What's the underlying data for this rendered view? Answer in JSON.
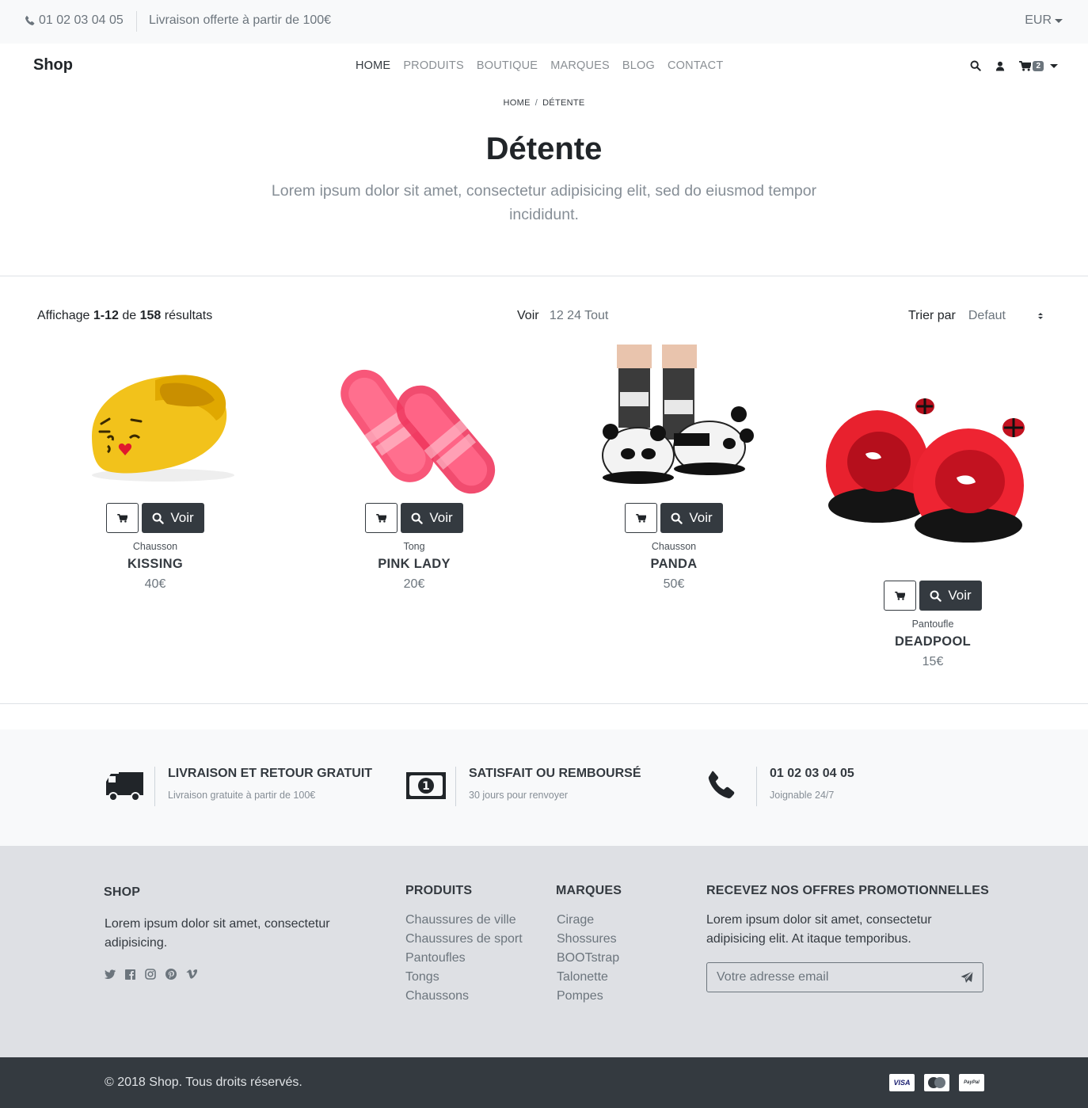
{
  "topbar": {
    "phone": "01 02 03 04 05",
    "delivery": "Livraison offerte à partir de 100€",
    "currency": "EUR"
  },
  "nav": {
    "brand": "Shop",
    "links": [
      "HOME",
      "PRODUITS",
      "BOUTIQUE",
      "MARQUES",
      "BLOG",
      "CONTACT"
    ],
    "cart_count": "2"
  },
  "hero": {
    "breadcrumb": [
      "HOME",
      "DÉTENTE"
    ],
    "title": "Détente",
    "lead": "Lorem ipsum dolor sit amet, consectetur adipisicing elit, sed do eiusmod tempor incididunt."
  },
  "listing": {
    "prefix": "Affichage",
    "range": "1-12",
    "of": "de",
    "total": "158",
    "suffix": "résultats",
    "per_page_label": "Voir",
    "per_page_options": [
      "12",
      "24",
      "Tout"
    ],
    "sort_label": "Trier par",
    "sort_value": "Defaut"
  },
  "products": [
    {
      "category": "Chausson",
      "name": "KISSING",
      "price": "40€",
      "button": "Voir"
    },
    {
      "category": "Tong",
      "name": "PINK LADY",
      "price": "20€",
      "button": "Voir"
    },
    {
      "category": "Chausson",
      "name": "PANDA",
      "price": "50€",
      "button": "Voir"
    },
    {
      "category": "Pantoufle",
      "name": "DEADPOOL",
      "price": "15€",
      "button": "Voir"
    }
  ],
  "services": [
    {
      "title": "LIVRAISON ET RETOUR GRATUIT",
      "subtitle": "Livraison gratuite à partir de 100€",
      "icon": "truck-icon"
    },
    {
      "title": "SATISFAIT OU REMBOURSÉ",
      "subtitle": "30 jours pour renvoyer",
      "icon": "money-icon"
    },
    {
      "title": "01 02 03 04 05",
      "subtitle": "Joignable 24/7",
      "icon": "phone-icon"
    }
  ],
  "footer": {
    "shop": {
      "heading": "SHOP",
      "text": "Lorem ipsum dolor sit amet, consectetur adipisicing."
    },
    "produits": {
      "heading": "PRODUITS",
      "links": [
        "Chaussures de ville",
        "Chaussures de sport",
        "Pantoufles",
        "Tongs",
        "Chaussons"
      ]
    },
    "marques": {
      "heading": "MARQUES",
      "links": [
        "Cirage",
        "Shossures",
        "BOOTstrap",
        "Talonette",
        "Pompes"
      ]
    },
    "newsletter": {
      "heading": "RECEVEZ NOS OFFRES PROMOTIONNELLES",
      "text": "Lorem ipsum dolor sit amet, consectetur adipisicing elit. At itaque temporibus.",
      "placeholder": "Votre adresse email"
    },
    "copyright": "© 2018   Shop. Tous droits réservés.",
    "payments": [
      "VISA",
      "MasterCard",
      "PayPal"
    ]
  }
}
